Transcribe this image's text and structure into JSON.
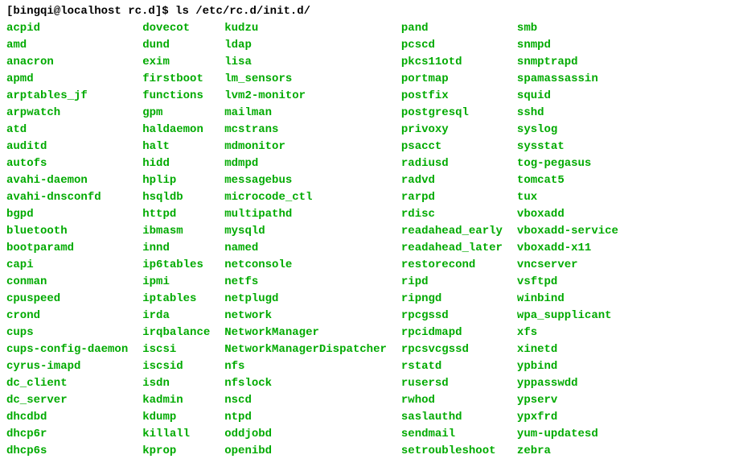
{
  "prompt": {
    "user_host": "[bingqi@localhost rc.d]",
    "dollar": "$",
    "command": "ls /etc/rc.d/init.d/"
  },
  "columns": [
    [
      "acpid",
      "amd",
      "anacron",
      "apmd",
      "arptables_jf",
      "arpwatch",
      "atd",
      "auditd",
      "autofs",
      "avahi-daemon",
      "avahi-dnsconfd",
      "bgpd",
      "bluetooth",
      "bootparamd",
      "capi",
      "conman",
      "cpuspeed",
      "crond",
      "cups",
      "cups-config-daemon",
      "cyrus-imapd",
      "dc_client",
      "dc_server",
      "dhcdbd",
      "dhcp6r",
      "dhcp6s"
    ],
    [
      "dovecot",
      "dund",
      "exim",
      "firstboot",
      "functions",
      "gpm",
      "haldaemon",
      "halt",
      "hidd",
      "hplip",
      "hsqldb",
      "httpd",
      "ibmasm",
      "innd",
      "ip6tables",
      "ipmi",
      "iptables",
      "irda",
      "irqbalance",
      "iscsi",
      "iscsid",
      "isdn",
      "kadmin",
      "kdump",
      "killall",
      "kprop"
    ],
    [
      "kudzu",
      "ldap",
      "lisa",
      "lm_sensors",
      "lvm2-monitor",
      "mailman",
      "mcstrans",
      "mdmonitor",
      "mdmpd",
      "messagebus",
      "microcode_ctl",
      "multipathd",
      "mysqld",
      "named",
      "netconsole",
      "netfs",
      "netplugd",
      "network",
      "NetworkManager",
      "NetworkManagerDispatcher",
      "nfs",
      "nfslock",
      "nscd",
      "ntpd",
      "oddjobd",
      "openibd"
    ],
    [
      "pand",
      "pcscd",
      "pkcs11otd",
      "portmap",
      "postfix",
      "postgresql",
      "privoxy",
      "psacct",
      "radiusd",
      "radvd",
      "rarpd",
      "rdisc",
      "readahead_early",
      "readahead_later",
      "restorecond",
      "ripd",
      "ripngd",
      "rpcgssd",
      "rpcidmapd",
      "rpcsvcgssd",
      "rstatd",
      "rusersd",
      "rwhod",
      "saslauthd",
      "sendmail",
      "setroubleshoot"
    ],
    [
      "smb",
      "snmpd",
      "snmptrapd",
      "spamassassin",
      "squid",
      "sshd",
      "syslog",
      "sysstat",
      "tog-pegasus",
      "tomcat5",
      "tux",
      "vboxadd",
      "vboxadd-service",
      "vboxadd-x11",
      "vncserver",
      "vsftpd",
      "winbind",
      "wpa_supplicant",
      "xfs",
      "xinetd",
      "ypbind",
      "yppasswdd",
      "ypserv",
      "ypxfrd",
      "yum-updatesd",
      "zebra"
    ]
  ]
}
